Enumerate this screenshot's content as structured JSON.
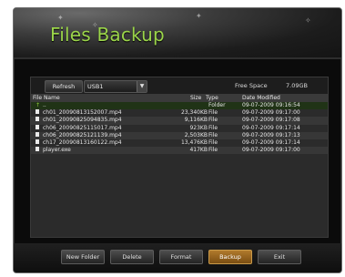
{
  "window": {
    "title": "Files Backup"
  },
  "toolbar": {
    "refresh_label": "Refresh",
    "device_selected": "USB1",
    "free_space_label": "Free Space",
    "free_space_value": "7.09GB"
  },
  "table": {
    "headers": {
      "name": "File Name",
      "size": "Size",
      "type": "Type",
      "date": "Date Modified"
    },
    "rows": [
      {
        "name": "..",
        "size": "",
        "type": "Folder",
        "date": "09-07-2009 09:16:54"
      },
      {
        "name": "ch01_20090813152007.mp4",
        "size": "23,340KB",
        "type": "File",
        "date": "09-07-2009 09:17:00"
      },
      {
        "name": "ch01_20090825094835.mp4",
        "size": "9,116KB",
        "type": "File",
        "date": "09-07-2009 09:17:08"
      },
      {
        "name": "ch06_20090825115017.mp4",
        "size": "923KB",
        "type": "File",
        "date": "09-07-2009 09:17:14"
      },
      {
        "name": "ch06_20090825121139.mp4",
        "size": "2,503KB",
        "type": "File",
        "date": "09-07-2009 09:17:13"
      },
      {
        "name": "ch17_20090813160122.mp4",
        "size": "13,476KB",
        "type": "File",
        "date": "09-07-2009 09:17:14"
      },
      {
        "name": "player.exe",
        "size": "417KB",
        "type": "File",
        "date": "09-07-2009 09:17:00"
      }
    ]
  },
  "footer": {
    "new_folder": "New Folder",
    "delete": "Delete",
    "format": "Format",
    "backup": "Backup",
    "exit": "Exit"
  }
}
